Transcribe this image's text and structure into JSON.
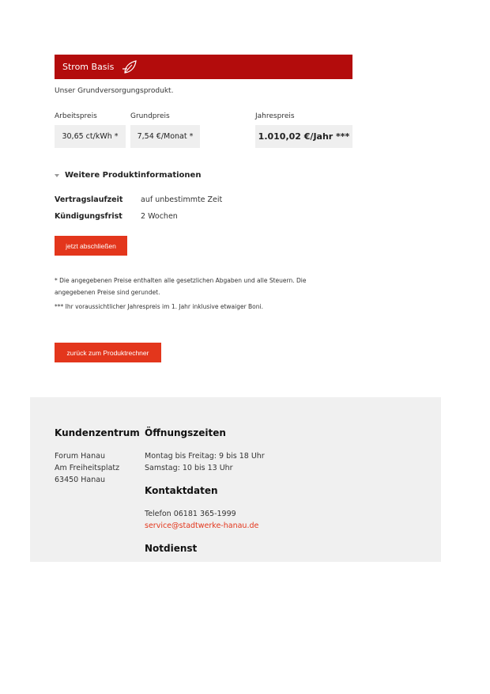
{
  "product": {
    "title": "Strom Basis",
    "icon": "leaf-icon",
    "description": "Unser Grundversorgungsprodukt.",
    "prices": {
      "arbeitspreis_label": "Arbeitspreis",
      "arbeitspreis_value": "30,65 ct/kWh *",
      "grundpreis_label": "Grundpreis",
      "grundpreis_value": "7,54 €/Monat *",
      "jahrespreis_label": "Jahrespreis",
      "jahrespreis_value": "1.010,02 €/Jahr ***"
    },
    "more_info_label": "Weitere Produktinformationen",
    "terms": [
      {
        "key": "Vertragslaufzeit",
        "value": "auf unbestimmte Zeit"
      },
      {
        "key": "Kündigungsfrist",
        "value": "2 Wochen"
      }
    ],
    "cta_label": "jetzt abschließen",
    "notes": [
      "* Die angegebenen Preise enthalten alle gesetzlichen Abgaben und alle Steuern. Die angegebenen Preise sind gerundet.",
      "*** Ihr voraussichtlicher Jahrespreis im 1. Jahr inklusive etwaiger Boni."
    ],
    "back_label": "zurück zum Produktrechner"
  },
  "footer": {
    "kundenzentrum": {
      "title": "Kundenzentrum",
      "lines": [
        "Forum Hanau",
        "Am Freiheitsplatz",
        "63450 Hanau"
      ]
    },
    "oeffnungszeiten": {
      "title": "Öffnungszeiten",
      "lines": [
        "Montag bis Freitag: 9 bis 18 Uhr",
        "Samstag: 10 bis 13 Uhr"
      ]
    },
    "kontakt": {
      "title": "Kontaktdaten",
      "phone": "Telefon 06181 365-1999",
      "email": "service@stadtwerke-hanau.de"
    },
    "notdienst_title": "Notdienst"
  },
  "colors": {
    "header_red": "#b30c0c",
    "button_red": "#e3361c",
    "footer_bg": "#f0f0f0"
  }
}
